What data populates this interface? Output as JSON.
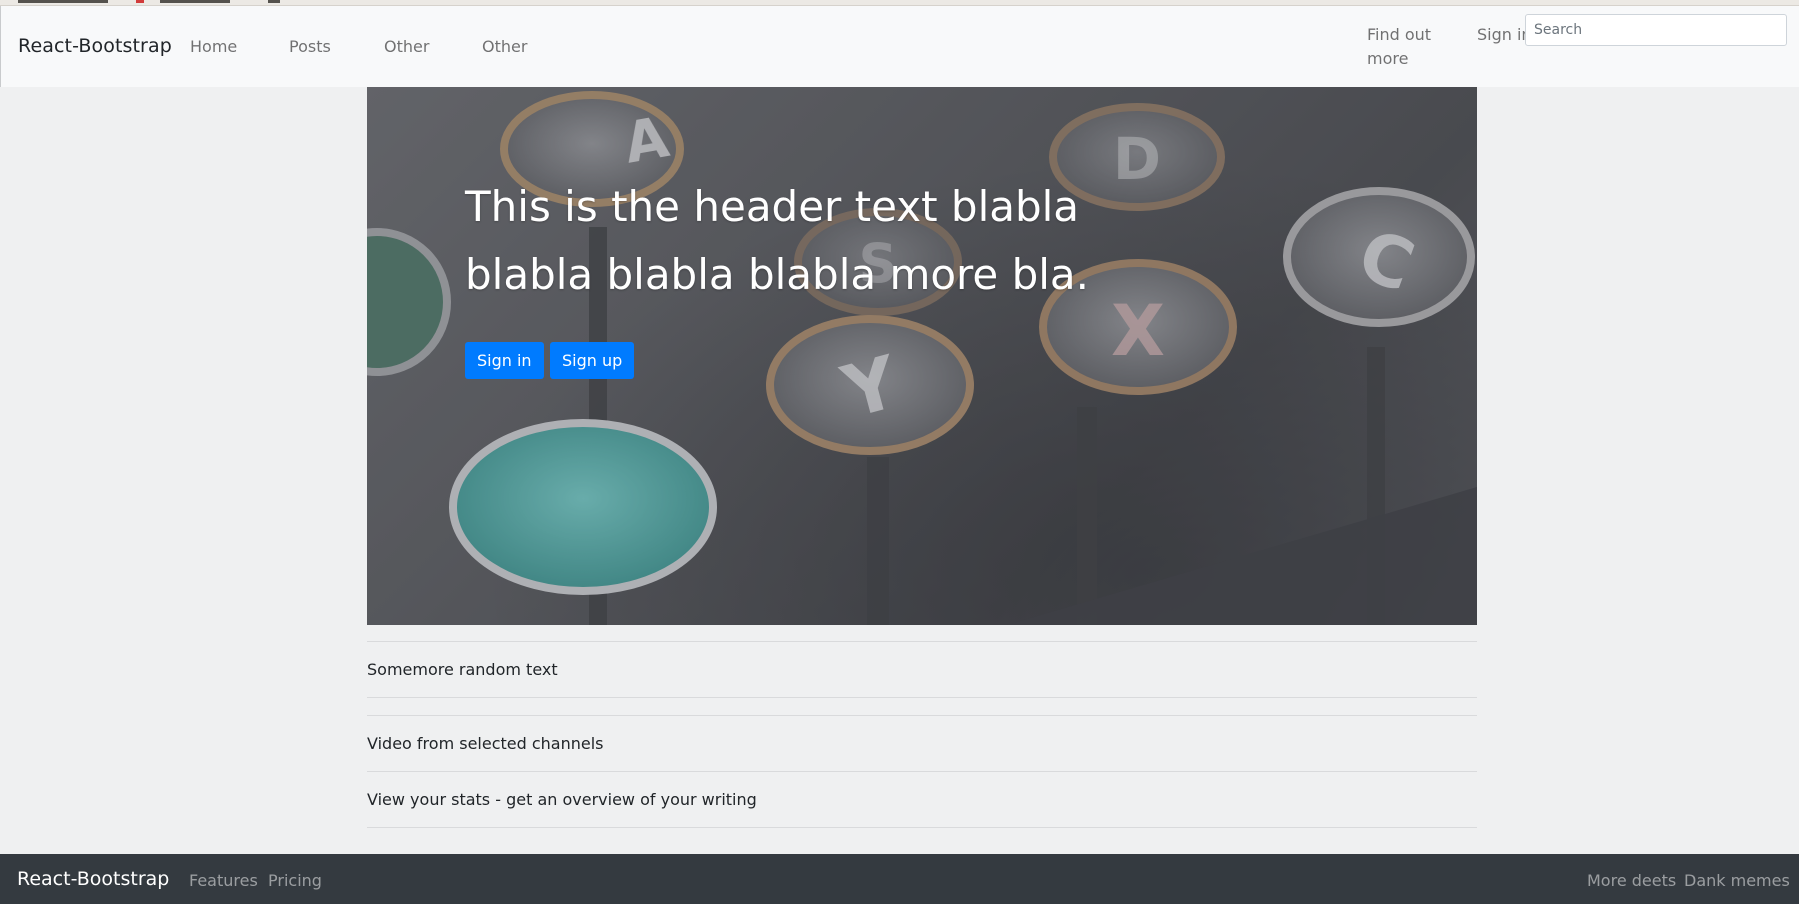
{
  "navbar": {
    "brand": "React-Bootstrap",
    "links": [
      "Home",
      "Posts",
      "Other",
      "Other"
    ],
    "find_out_more_line1": "Find out",
    "find_out_more_line2": "more",
    "sign_in": "Sign in",
    "search_placeholder": "Search"
  },
  "hero": {
    "title": "This is the header text blabla blabla blabla blabla more bla.",
    "sign_in_label": "Sign in",
    "sign_up_label": "Sign up",
    "image_keys": [
      "A",
      "D",
      "S",
      "C",
      "X",
      "Y"
    ]
  },
  "list": {
    "group1": [
      "Somemore random text"
    ],
    "group2": [
      "Video from selected channels",
      "View your stats - get an overview of your writing"
    ]
  },
  "footer": {
    "brand": "React-Bootstrap",
    "left_links": [
      "Features",
      "Pricing"
    ],
    "right_links": [
      "More deets",
      "Dank memes"
    ]
  },
  "colors": {
    "primary": "#007bff",
    "navbar_bg": "#f8f9fa",
    "footer_bg": "#343a40",
    "page_bg": "#eff0f1"
  }
}
